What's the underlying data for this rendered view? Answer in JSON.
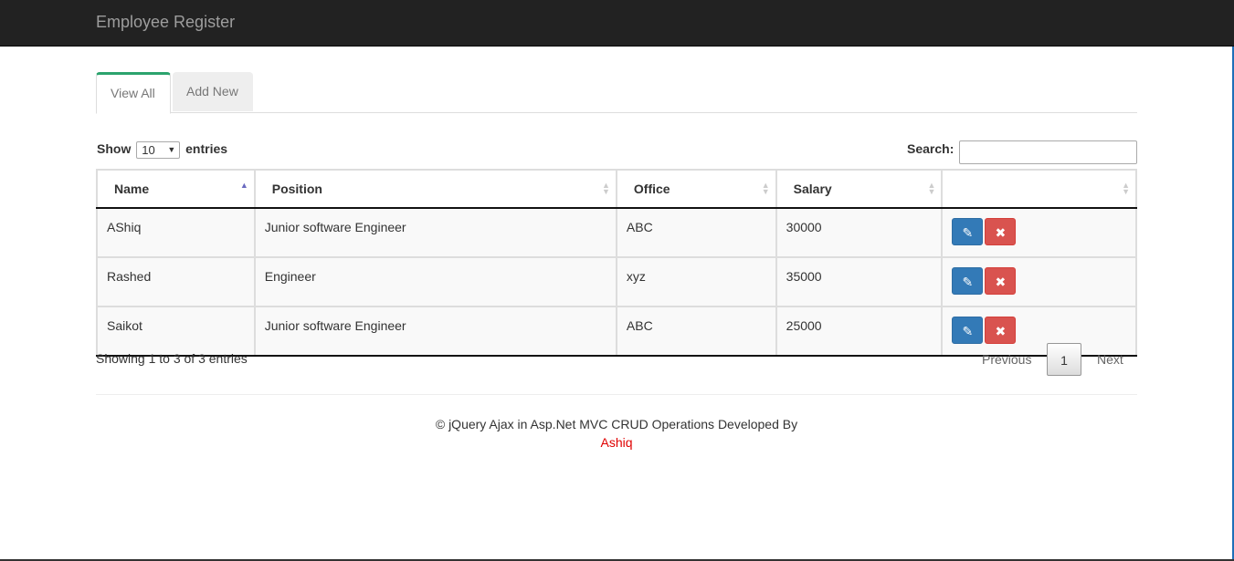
{
  "app": {
    "brand": "Employee Register"
  },
  "tabs": [
    {
      "label": "View All",
      "active": true
    },
    {
      "label": "Add New",
      "active": false
    }
  ],
  "length_menu": {
    "prefix": "Show",
    "value": "10",
    "suffix": "entries"
  },
  "search": {
    "label": "Search:",
    "value": ""
  },
  "table": {
    "headers": [
      "Name",
      "Position",
      "Office",
      "Salary",
      ""
    ],
    "rows": [
      {
        "name": "AShiq",
        "position": "Junior software Engineer",
        "office": "ABC",
        "salary": "30000"
      },
      {
        "name": "Rashed",
        "position": "Engineer",
        "office": "xyz",
        "salary": "35000"
      },
      {
        "name": "Saikot",
        "position": "Junior software Engineer",
        "office": "ABC",
        "salary": "25000"
      }
    ]
  },
  "info": "Showing 1 to 3 of 3 entries",
  "pagination": {
    "previous": "Previous",
    "current": "1",
    "next": "Next"
  },
  "footer": {
    "text": "© jQuery Ajax in Asp.Net MVC CRUD Operations Developed By",
    "author": "Ashiq"
  },
  "colors": {
    "navbar": "#222222",
    "tab_accent": "#2ba36d",
    "edit": "#337ab7",
    "delete": "#d9534f",
    "author": "#e00000"
  }
}
